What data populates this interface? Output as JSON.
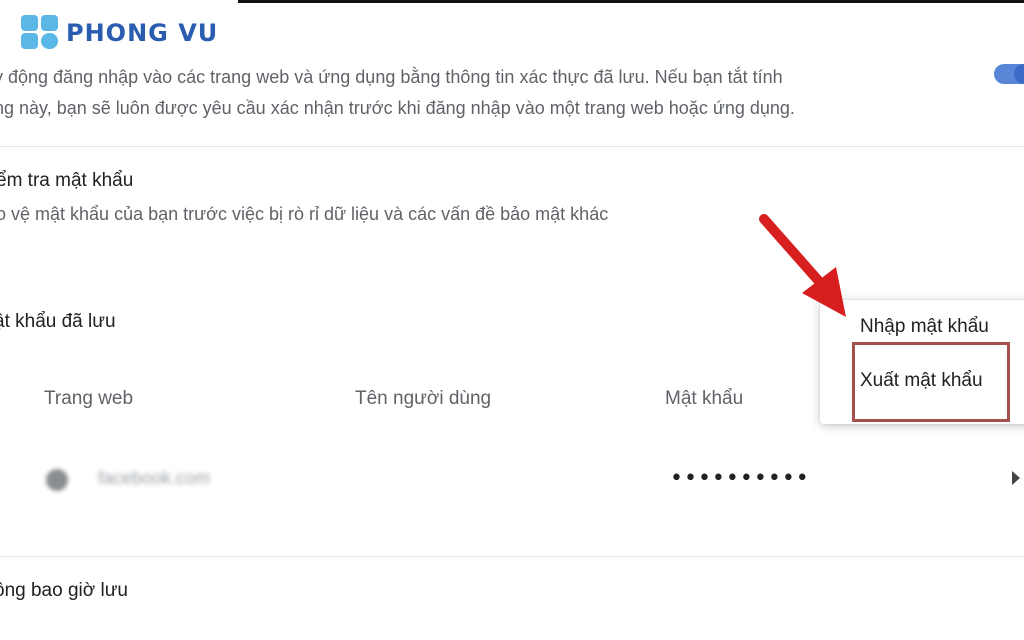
{
  "brand": {
    "name": "PHONG VU"
  },
  "autosignin": {
    "line1": "y động đăng nhập vào các trang web và ứng dụng bằng thông tin xác thực đã lưu. Nếu bạn tắt tính",
    "line2": "ng này, bạn sẽ luôn được yêu cầu xác nhận trước khi đăng nhập vào một trang web hoặc ứng dụng.",
    "toggle_on": true
  },
  "password_check": {
    "title": "ểm tra mật khẩu",
    "description": "o vệ mật khẩu của bạn trước việc bị rò rỉ dữ liệu và các vấn đề bảo mật khác"
  },
  "saved_passwords": {
    "title": "ật khẩu đã lưu",
    "columns": [
      "Trang web",
      "Tên người dùng",
      "Mật khẩu"
    ],
    "rows": [
      {
        "site": "facebook.com",
        "username": "",
        "password": "••••••••••"
      }
    ]
  },
  "never_saved": {
    "title": "ông bao giờ lưu"
  },
  "menu": {
    "items": [
      "Nhập mật khẩu",
      "Xuất mật khẩu"
    ],
    "highlighted_index": 1
  },
  "colors": {
    "brand_blue": "#2a5db0",
    "brand_light": "#5bb8e6",
    "arrow_red": "#d81f1f",
    "highlight_border": "#a3514d",
    "toggle_blue": "#3b6bc9"
  }
}
